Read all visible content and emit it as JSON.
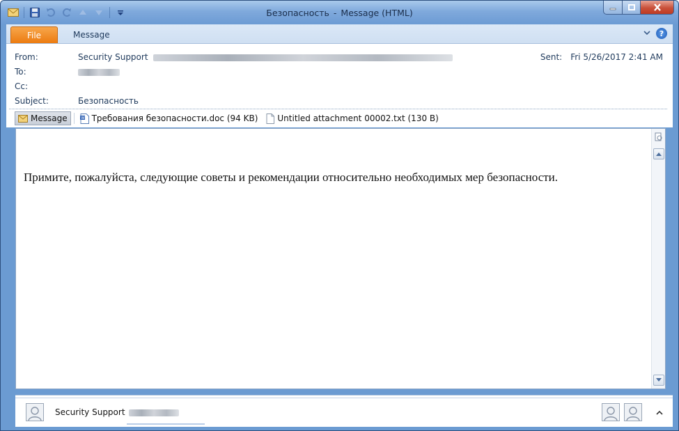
{
  "window": {
    "title_subject": "Безопасность",
    "title_separator": "-",
    "title_suffix": "Message (HTML)"
  },
  "ribbon": {
    "file_tab": "File",
    "message_tab": "Message"
  },
  "header": {
    "from_label": "From:",
    "from_name": "Security Support",
    "to_label": "To:",
    "cc_label": "Cc:",
    "subject_label": "Subject:",
    "subject_value": "Безопасность",
    "sent_label": "Sent:",
    "sent_value": "Fri 5/26/2017 2:41 AM"
  },
  "attachments": {
    "message_label": "Message",
    "items": [
      {
        "name": "Требования безопасности.doc (94 KB)",
        "icon": "word-doc-icon"
      },
      {
        "name": "Untitled attachment 00002.txt (130 B)",
        "icon": "text-file-icon"
      }
    ]
  },
  "body": {
    "text": "Примите, пожалуйста, следующие советы и рекомендации относительно необходимых мер безопасности."
  },
  "people_pane": {
    "name": "Security Support"
  },
  "colors": {
    "title_bar": "#7fa9dc",
    "file_tab": "#ec7b10",
    "close_button": "#c9503a",
    "label_text": "#1e395b"
  }
}
